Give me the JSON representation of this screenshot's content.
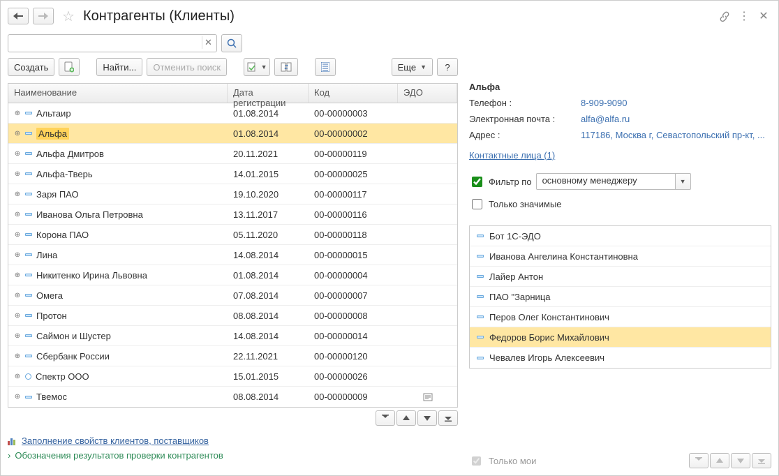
{
  "title": "Контрагенты (Клиенты)",
  "toolbar": {
    "create_label": "Создать",
    "find_label": "Найти...",
    "cancel_search_label": "Отменить поиск",
    "more_label": "Еще",
    "help_label": "?"
  },
  "search": {
    "value": "",
    "placeholder": ""
  },
  "grid": {
    "headers": {
      "name": "Наименование",
      "date": "Дата регистрации",
      "code": "Код",
      "edo": "ЭДО"
    },
    "rows": [
      {
        "name": "Альтаир",
        "date": "01.08.2014",
        "code": "00-00000003",
        "mark": "bar",
        "edo_icon": false
      },
      {
        "name": "Альфа",
        "date": "01.08.2014",
        "code": "00-00000002",
        "mark": "bar",
        "selected": true,
        "edo_icon": false
      },
      {
        "name": "Альфа Дмитров",
        "date": "20.11.2021",
        "code": "00-00000119",
        "mark": "bar",
        "edo_icon": false
      },
      {
        "name": "Альфа-Тверь",
        "date": "14.01.2015",
        "code": "00-00000025",
        "mark": "bar",
        "edo_icon": false
      },
      {
        "name": "Заря ПАО",
        "date": "19.10.2020",
        "code": "00-00000117",
        "mark": "bar",
        "edo_icon": false
      },
      {
        "name": "Иванова Ольга Петровна",
        "date": "13.11.2017",
        "code": "00-00000116",
        "mark": "bar",
        "edo_icon": false
      },
      {
        "name": "Корона ПАО",
        "date": "05.11.2020",
        "code": "00-00000118",
        "mark": "bar",
        "edo_icon": false
      },
      {
        "name": "Лина",
        "date": "14.08.2014",
        "code": "00-00000015",
        "mark": "bar",
        "edo_icon": false
      },
      {
        "name": "Никитенко Ирина Львовна",
        "date": "01.08.2014",
        "code": "00-00000004",
        "mark": "bar",
        "edo_icon": false
      },
      {
        "name": "Омега",
        "date": "07.08.2014",
        "code": "00-00000007",
        "mark": "bar",
        "edo_icon": false
      },
      {
        "name": "Протон",
        "date": "08.08.2014",
        "code": "00-00000008",
        "mark": "bar",
        "edo_icon": false
      },
      {
        "name": "Саймон и Шустер",
        "date": "14.08.2014",
        "code": "00-00000014",
        "mark": "bar",
        "edo_icon": false
      },
      {
        "name": "Сбербанк России",
        "date": "22.11.2021",
        "code": "00-00000120",
        "mark": "bar",
        "edo_icon": false
      },
      {
        "name": "Спектр ООО",
        "date": "15.01.2015",
        "code": "00-00000026",
        "mark": "circle",
        "edo_icon": false
      },
      {
        "name": "Твемос",
        "date": "08.08.2014",
        "code": "00-00000009",
        "mark": "bar",
        "edo_icon": true
      }
    ]
  },
  "footer": {
    "link1": "Заполнение свойств клиентов, поставщиков",
    "link2": "Обозначения результатов проверки контрагентов"
  },
  "detail": {
    "title": "Альфа",
    "phone_label": "Телефон :",
    "phone_value": "8-909-9090",
    "email_label": "Электронная почта :",
    "email_value": "alfa@alfa.ru",
    "address_label": "Адрес :",
    "address_value": "117186, Москва г, Севастопольский пр-кт, ...",
    "contacts_link": "Контактные лица (1)"
  },
  "filter": {
    "filter_by_label": "Фильтр по",
    "filter_by_checked": true,
    "filter_value": "основному менеджеру",
    "only_significant_label": "Только значимые",
    "only_significant_checked": false
  },
  "managers": [
    {
      "name": "Бот 1С-ЭДО"
    },
    {
      "name": "Иванова Ангелина Константиновна"
    },
    {
      "name": "Лайер Антон"
    },
    {
      "name": "ПАО \"Зарница"
    },
    {
      "name": "Перов Олег Константинович"
    },
    {
      "name": "Федоров Борис Михайлович",
      "selected": true
    },
    {
      "name": "Чевалев Игорь Алексеевич"
    }
  ],
  "right_footer": {
    "only_mine_label": "Только мои",
    "only_mine_checked": true
  }
}
